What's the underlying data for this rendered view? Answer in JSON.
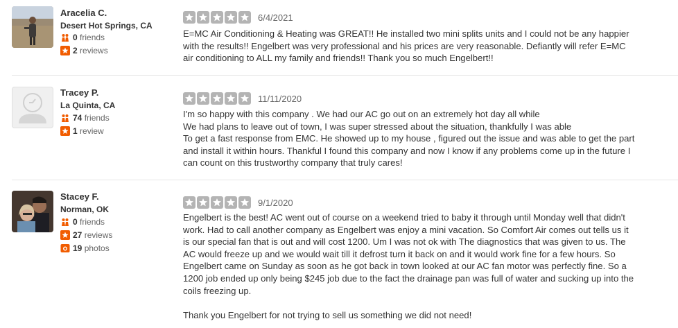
{
  "reviews": [
    {
      "user": {
        "name": "Aracelia C.",
        "location": "Desert Hot Springs, CA",
        "friends": "0",
        "friends_label": "friends",
        "reviews": "2",
        "reviews_label": "reviews"
      },
      "rating": 5,
      "date": "6/4/2021",
      "text": "E=MC Air Conditioning & Heating was GREAT!! He installed two mini splits units and I could not be any happier\nwith the results!!  Engelbert was very professional and his prices are very reasonable. Defiantly will refer E=MC\nair conditioning to ALL my family and friends!! Thank you so much Engelbert!!"
    },
    {
      "user": {
        "name": "Tracey P.",
        "location": "La Quinta, CA",
        "friends": "74",
        "friends_label": "friends",
        "reviews": "1",
        "reviews_label": "review"
      },
      "rating": 5,
      "date": "11/11/2020",
      "text": "I'm so happy with this company . We had our AC go out on an extremely hot day all while\nWe had plans to leave out of town, I was super stressed about the situation, thankfully I was able\nTo get a fast response from EMC. He showed up to my house , figured out the issue and was able to get the part\nand install it within hours. Thankful I found this company and now I know if any problems come up in the future I\ncan count on this trustworthy company that truly cares!"
    },
    {
      "user": {
        "name": "Stacey F.",
        "location": "Norman, OK",
        "friends": "0",
        "friends_label": "friends",
        "reviews": "27",
        "reviews_label": "reviews",
        "photos": "19",
        "photos_label": "photos"
      },
      "rating": 5,
      "date": "9/1/2020",
      "text": "Engelbert is the best!  AC went out of course on a weekend tried to baby it through until Monday well that didn't\nwork. Had to call another company as Engelbert was enjoy a mini vacation. So Comfort Air comes out tells us it\nis our special fan that is out and will cost 1200.  Um I was not ok with The diagnostics that was given to us. The\nAC would freeze up and we would wait till it defrost turn it back on and it would work fine for a few hours. So\nEngelbert came on Sunday as soon as he got back in town looked at our AC fan motor was perfectly fine. So a\n1200 job ended up only being $245 job due to the fact the drainage pan was full of water and sucking up into the\ncoils freezing up.\n\nThank you Engelbert for not trying to sell us something we did not need!"
    }
  ],
  "colors": {
    "star_empty": "#b4b4b4",
    "stat_icon": "#f15c00",
    "divider": "#e6e6e6"
  }
}
